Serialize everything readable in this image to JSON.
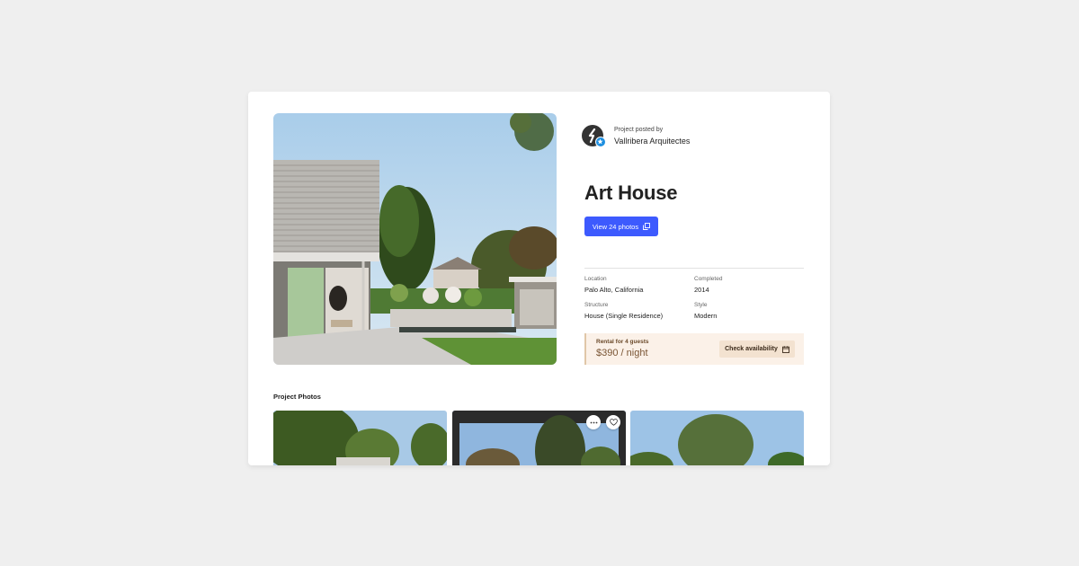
{
  "poster": {
    "label": "Project posted by",
    "name": "Vallribera Arquitectes",
    "avatar_icon": "vallribera-logo-icon",
    "badge_icon": "verified-star-icon"
  },
  "project": {
    "title": "Art House",
    "view_photos_label": "View 24 photos",
    "view_photos_icon": "gallery-icon"
  },
  "details": [
    {
      "key": "Location",
      "value": "Palo Alto, California"
    },
    {
      "key": "Completed",
      "value": "2014"
    },
    {
      "key": "Structure",
      "value": "House (Single Residence)"
    },
    {
      "key": "Style",
      "value": "Modern"
    }
  ],
  "rental": {
    "label": "Rental for 4 guests",
    "price": "$390",
    "unit": "/ night",
    "check_label": "Check availability",
    "check_icon": "calendar-icon"
  },
  "photos": {
    "section_title": "Project Photos",
    "more_icon": "more-dots-icon",
    "save_icon": "heart-icon"
  },
  "colors": {
    "accent": "#3d5afe",
    "rental_bg": "#fbf1e8",
    "verified": "#1e8fe0"
  }
}
